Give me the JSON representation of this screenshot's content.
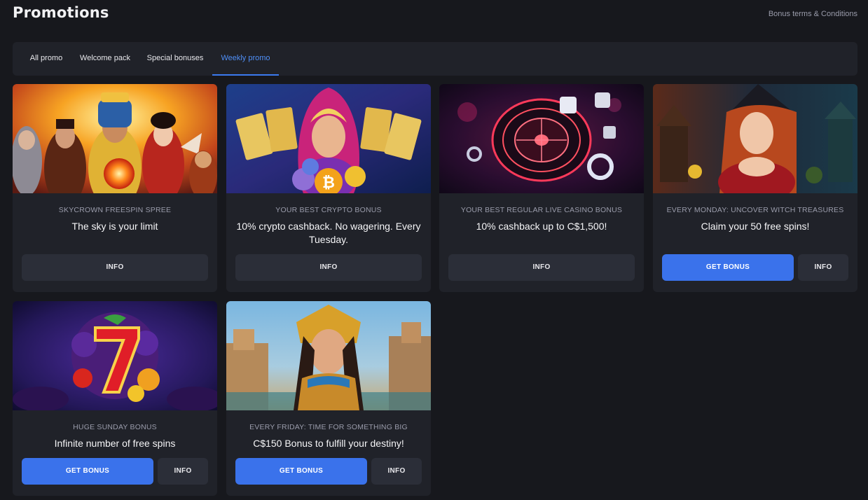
{
  "header": {
    "title": "Promotions",
    "terms_link": "Bonus terms & Conditions"
  },
  "tabs": [
    {
      "label": "All promo",
      "active": false
    },
    {
      "label": "Welcome pack",
      "active": false
    },
    {
      "label": "Special bonuses",
      "active": false
    },
    {
      "label": "Weekly promo",
      "active": true
    }
  ],
  "colors": {
    "background": "#17181d",
    "card": "#202229",
    "accent": "#3a72eb",
    "info_button": "#2b2e38"
  },
  "cards": [
    {
      "subtitle": "SKYCROWN FREESPIN SPREE",
      "title": "The sky is your limit",
      "get_bonus": null,
      "info": "INFO",
      "image": "heroes-group-artwork"
    },
    {
      "subtitle": "YOUR BEST CRYPTO BONUS",
      "title": "10% crypto cashback. No wagering. Every Tuesday.",
      "get_bonus": null,
      "info": "INFO",
      "image": "fortune-teller-crypto-artwork"
    },
    {
      "subtitle": "YOUR BEST REGULAR LIVE CASINO BONUS",
      "title": "10% cashback up to C$1,500!",
      "get_bonus": null,
      "info": "INFO",
      "image": "neon-roulette-artwork"
    },
    {
      "subtitle": "EVERY MONDAY: UNCOVER WITCH TREASURES",
      "title": "Claim your 50 free spins!",
      "get_bonus": "GET BONUS",
      "info": "INFO",
      "image": "witch-artwork"
    },
    {
      "subtitle": "HUGE SUNDAY BONUS",
      "title": "Infinite number of free spins",
      "get_bonus": "GET BONUS",
      "info": "INFO",
      "image": "lucky-seven-fruits-artwork"
    },
    {
      "subtitle": "EVERY FRIDAY: TIME FOR SOMETHING BIG",
      "title": "C$150 Bonus to fulfill your destiny!",
      "get_bonus": "GET BONUS",
      "info": "INFO",
      "image": "egyptian-queen-artwork"
    }
  ]
}
